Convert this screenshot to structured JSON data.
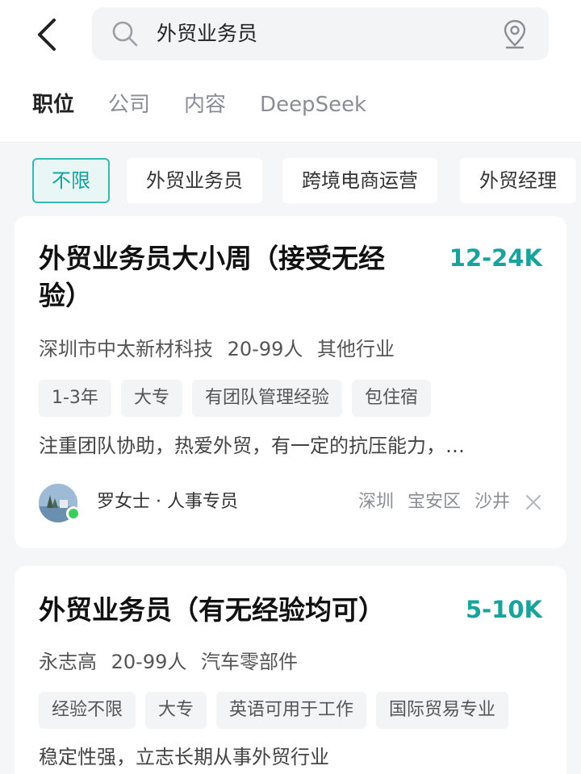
{
  "search": {
    "query": "外贸业务员"
  },
  "tabs": [
    "职位",
    "公司",
    "内容",
    "DeepSeek"
  ],
  "filters": [
    "不限",
    "外贸业务员",
    "跨境电商运营",
    "外贸经理"
  ],
  "jobs": [
    {
      "title_line1": "外贸业务员大小周（接受无经",
      "title_line2": "验）",
      "salary": "12-24K",
      "company": "深圳市中太新材科技",
      "size": "20-99人",
      "industry": "其他行业",
      "tags": [
        "1-3年",
        "大专",
        "有团队管理经验",
        "包住宿"
      ],
      "description": "注重团队协助，热爱外贸，有一定的抗压能力，…",
      "recruiter": "罗女士 · 人事专员",
      "location": [
        "深圳",
        "宝安区",
        "沙井"
      ]
    },
    {
      "title_line1": "外贸业务员（有无经验均可）",
      "salary": "5-10K",
      "company": "永志高",
      "size": "20-99人",
      "industry": "汽车零部件",
      "tags": [
        "经验不限",
        "大专",
        "英语可用于工作",
        "国际贸易专业"
      ],
      "description": "稳定性强，立志长期从事外贸行业"
    }
  ],
  "colors": {
    "accent": "#1aa39b",
    "online": "#3ccc5a"
  }
}
